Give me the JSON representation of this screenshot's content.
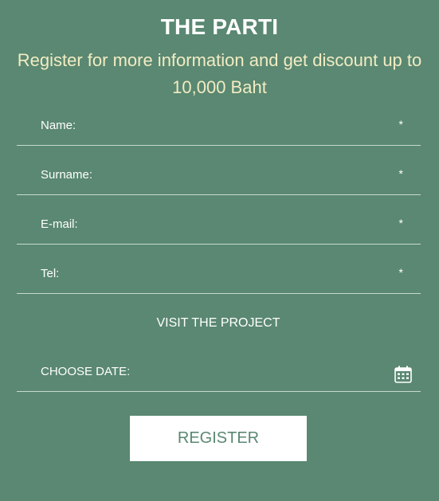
{
  "header": {
    "title": "THE PARTI",
    "subtitle": "Register for more information and get discount up to 10,000 Baht"
  },
  "fields": [
    {
      "label": "Name:",
      "required": "*"
    },
    {
      "label": "Surname:",
      "required": "*"
    },
    {
      "label": "E-mail:",
      "required": "*"
    },
    {
      "label": "Tel:",
      "required": "*"
    }
  ],
  "visit": {
    "heading": "VISIT THE PROJECT",
    "date_label": "CHOOSE DATE:",
    "date_icon": "calendar-icon"
  },
  "submit": {
    "label": "REGISTER"
  },
  "colors": {
    "background": "#5a8872",
    "subtitle": "#f2ecc2",
    "button_text": "#5a8872"
  }
}
